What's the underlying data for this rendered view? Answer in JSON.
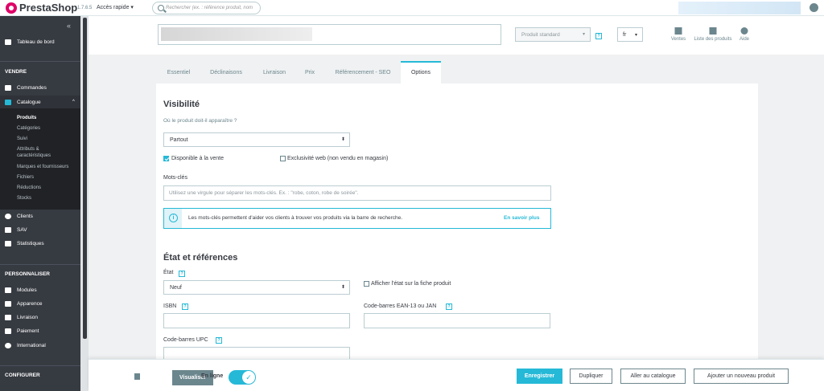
{
  "topbar": {
    "logo": "PrestaShop",
    "version": "1.7.6.5",
    "quick_access": "Accès rapide ▾",
    "search_placeholder": "Rechercher (ex. : référence produit, nom"
  },
  "sidebar": {
    "collapse": "«",
    "dashboard": "Tableau de bord",
    "section_sell": "VENDRE",
    "orders": "Commandes",
    "catalog": "Catalogue",
    "catalog_chevron": "^",
    "catalog_sub": [
      "Produits",
      "Catégories",
      "Suivi",
      "Attributs &",
      "caractéristiques",
      "Marques et fournisseurs",
      "Fichiers",
      "Réductions",
      "Stocks"
    ],
    "customers": "Clients",
    "sav": "SAV",
    "stats": "Statistiques",
    "section_customize": "PERSONNALISER",
    "modules": "Modules",
    "appearance": "Apparence",
    "shipping": "Livraison",
    "payment": "Paiement",
    "international": "International",
    "section_configure": "CONFIGURER"
  },
  "product_header": {
    "type": "Produit standard",
    "type_arrow": "▾",
    "help": "?",
    "lang": "fr",
    "lang_arrow": "▾",
    "tools": [
      "Ventes",
      "Liste des produits",
      "Aide"
    ]
  },
  "tabs": [
    "Essentiel",
    "Déclinaisons",
    "Livraison",
    "Prix",
    "Référencement - SEO",
    "Options"
  ],
  "options": {
    "visibility_title": "Visibilité",
    "visibility_question": "Où le produit doit-il apparaître ?",
    "visibility_value": "Partout",
    "select_arrow": "⬍",
    "available_for_order": "Disponible à la vente",
    "web_only": "Exclusivité web (non vendu en magasin)",
    "keywords_label": "Mots-clés",
    "keywords_placeholder": "Utilisez une virgule pour séparer les mots-clés. Ex. : \"robe, coton, robe de soirée\".",
    "info_icon": "i",
    "info_text": "Les mots-clés permettent d'aider vos clients à trouver vos produits via la barre de recherche.",
    "info_link": "En savoir plus",
    "state_title": "État et références",
    "condition_label": "État",
    "condition_value": "Neuf",
    "show_condition": "Afficher l'état sur la fiche produit",
    "isbn_label": "ISBN",
    "ean_label": "Code-barres EAN-13 ou JAN",
    "upc_label": "Code-barres UPC"
  },
  "footer": {
    "preview": "Visualiser",
    "online": "En ligne",
    "toggle_check": "✓",
    "save": "Enregistrer",
    "duplicate": "Dupliquer",
    "go_catalog": "Aller au catalogue",
    "add_new": "Ajouter un nouveau produit"
  },
  "colors": {
    "accent": "#25b9d7",
    "sidebar": "#363a41",
    "brand": "#df0067"
  }
}
